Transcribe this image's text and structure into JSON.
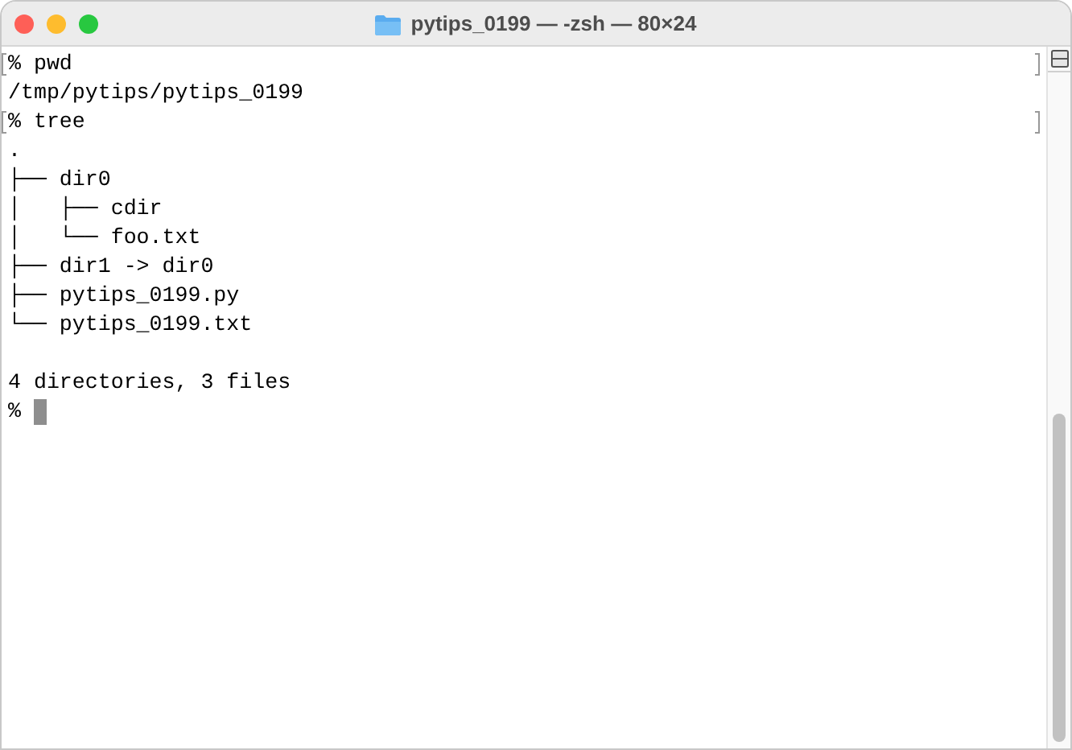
{
  "window": {
    "title": "pytips_0199 — -zsh — 80×24"
  },
  "session": [
    {
      "command": "% pwd",
      "marked": true,
      "output": [
        [
          "/tmp/pytips/pytips_0199"
        ]
      ]
    },
    {
      "command": "% tree",
      "marked": true,
      "output": [
        [
          ".",
          "├── dir0",
          "│   ├── cdir",
          "│   └── foo.txt",
          "├── dir1 -> dir0",
          "├── pytips_0199.py",
          "└── pytips_0199.txt"
        ],
        [
          "4 directories, 3 files"
        ]
      ]
    },
    {
      "command": "%",
      "marked": false,
      "cursor": true
    }
  ]
}
